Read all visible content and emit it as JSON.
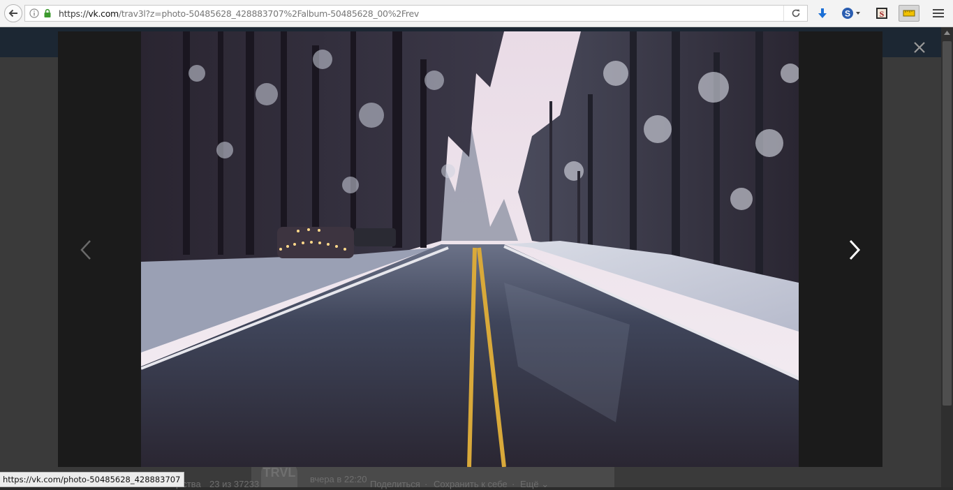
{
  "browser": {
    "url_prefix": "https://",
    "url_host": "vk.com",
    "url_path": "/trav3l?z=photo-50485628_428883707%2Falbum-50485628_00%2Frev"
  },
  "viewer": {
    "photo_alt": "Snowy forest road",
    "close_symbol": "✕"
  },
  "page": {
    "community_label": "бщества",
    "counter": "23 из 37233",
    "avatar_text": "TRVL",
    "post_time": "вчера в 22:20",
    "share_label": "Поделиться",
    "save_label": "Сохранить к себе",
    "more_label": "Ещё",
    "separator": "·"
  },
  "status_bar": {
    "link_url": "https://vk.com/photo-50485628_428883707"
  },
  "icons": {
    "back": "back-arrow-icon",
    "info": "info-icon",
    "lock": "lock-icon",
    "reload": "reload-icon",
    "download": "download-arrow-icon",
    "sync": "s-extension-icon",
    "ext_s": "s-square-extension-icon",
    "ruler": "ruler-icon",
    "menu": "hamburger-menu-icon",
    "prev": "chevron-left-icon",
    "next": "chevron-right-icon",
    "close": "close-icon"
  },
  "colors": {
    "download_blue": "#1a6fd6",
    "sync_blue": "#2a5db0",
    "viewer_bg": "#1b1b1b",
    "page_header": "#1c2733"
  }
}
